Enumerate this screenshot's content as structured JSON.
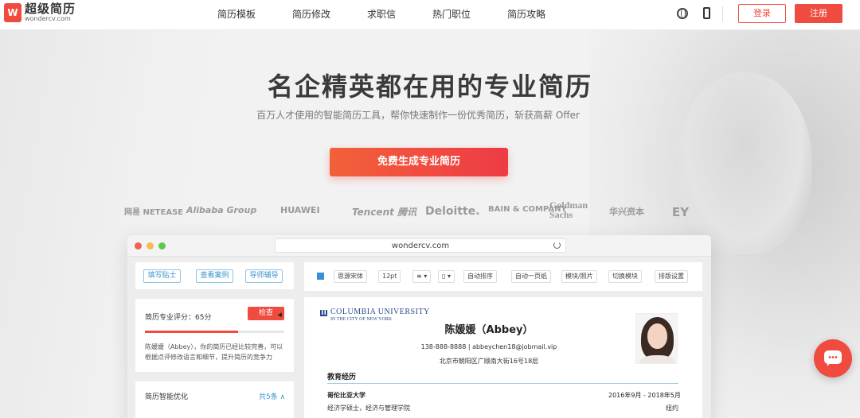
{
  "header": {
    "logo_mark": "W",
    "logo_name": "超级简历",
    "logo_url": "wondercv.com",
    "nav": [
      "简历模板",
      "简历修改",
      "求职信",
      "热门职位",
      "简历攻略"
    ],
    "login": "登录",
    "register": "注册"
  },
  "hero": {
    "title": "名企精英都在用的专业简历",
    "subtitle": "百万人才使用的智能简历工具，帮你快速制作一份优秀简历，斩获高薪 Offer",
    "cta": "免费生成专业简历"
  },
  "partners": [
    "网易 NETEASE",
    "Alibaba Group",
    "HUAWEI",
    "Tencent 腾讯",
    "Deloitte.",
    "BAIN & COMPANY",
    "Goldman Sachs",
    "华兴资本",
    "EY"
  ],
  "browser": {
    "url": "wondercv.com",
    "left_tabs": [
      "填写贴士",
      "查看案例",
      "导师辅导"
    ],
    "score_label": "简历专业评分：65分",
    "score_value": 0.67,
    "check_btn": "检查",
    "score_desc": "陈媛媛（Abbey），你的简历已经比较完善，可以根据点评修改语言和细节，提升简历的竞争力",
    "opt_label": "简历智能优化",
    "opt_count": "共5条",
    "toolbar": [
      "思源宋体",
      "12pt",
      "自动排序",
      "自动一页纸",
      "模块/照片",
      "切换模块",
      "排版设置"
    ],
    "accent_color": "#3a8fd9"
  },
  "resume": {
    "school_logo": "COLUMBIA UNIVERSITY",
    "school_logo_sub": "IN THE CITY OF NEW YORK",
    "name": "陈媛媛（Abbey）",
    "contact": "138-888-8888 | abbeychen18@jobmail.vip",
    "address": "北京市朝阳区广顺南大街16号18层",
    "section": "教育经历",
    "school": "哥伦比亚大学",
    "dates": "2016年9月 - 2018年5月",
    "degree": "经济学硕士，经济与管理学院",
    "city": "纽约"
  },
  "colors": {
    "brand": "#ef4b3f",
    "link": "#3a94cc"
  }
}
